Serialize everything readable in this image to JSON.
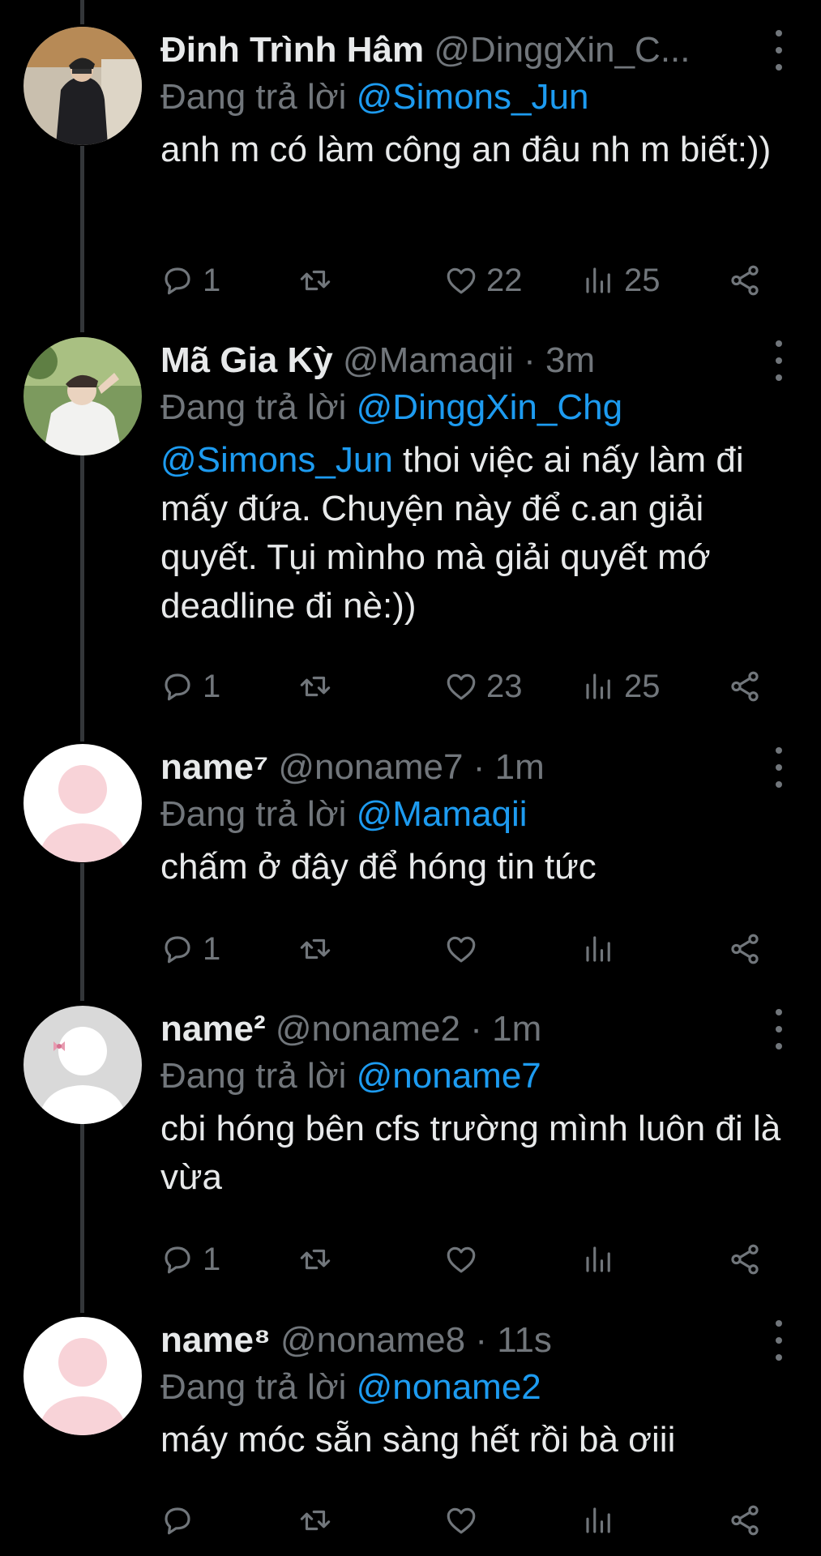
{
  "tweets": [
    {
      "name": "Đinh Trình Hâm",
      "handle": "@DinggXin_C...",
      "time": "",
      "reply_prefix": "Đang trả lời",
      "reply_to": "@Simons_Jun",
      "text_mention": "",
      "text": "anh m có làm công an đâu nh m biết:))",
      "replies": "1",
      "likes": "22",
      "views": "25",
      "avatar": "photo-person-black-outfit"
    },
    {
      "name": "Mã Gia Kỳ",
      "handle": "@Mamaqii",
      "time": "· 3m",
      "reply_prefix": "Đang trả lời",
      "reply_to": "@DinggXin_Chg",
      "text_mention": "@Simons_Jun",
      "text": " thoi việc ai nấy làm đi mấy đứa. Chuyện này để c.an giải quyết. Tụi mìnho mà giải quyết mớ deadline đi nè:))",
      "replies": "1",
      "likes": "23",
      "views": "25",
      "avatar": "photo-person-white-shirt"
    },
    {
      "name": "name⁷",
      "handle": "@noname7",
      "time": "· 1m",
      "reply_prefix": "Đang trả lời",
      "reply_to": "@Mamaqii",
      "text_mention": "",
      "text": "chấm ở đây để hóng tin tức",
      "replies": "1",
      "likes": "",
      "views": "",
      "avatar": "default-pink-silhouette"
    },
    {
      "name": "name²",
      "handle": "@noname2",
      "time": "· 1m",
      "reply_prefix": "Đang trả lời",
      "reply_to": "@noname7",
      "text_mention": "",
      "text": "cbi hóng bên cfs trường mình luôn đi là vừa",
      "replies": "1",
      "likes": "",
      "views": "",
      "avatar": "default-grey-silhouette-bow"
    },
    {
      "name": "name⁸",
      "handle": "@noname8",
      "time": "· 11s",
      "reply_prefix": "Đang trả lời",
      "reply_to": "@noname2",
      "text_mention": "",
      "text": "máy móc sẵn sàng hết rồi bà ơiii",
      "replies": "",
      "likes": "",
      "views": "",
      "avatar": "default-pink-silhouette"
    }
  ],
  "colors": {
    "background": "#000000",
    "text": "#e7e9ea",
    "muted": "#71767b",
    "accent": "#1d9bf0",
    "thread_line": "#333639"
  },
  "icons": [
    "reply-icon",
    "retweet-icon",
    "like-icon",
    "views-icon",
    "share-icon",
    "more-icon"
  ]
}
